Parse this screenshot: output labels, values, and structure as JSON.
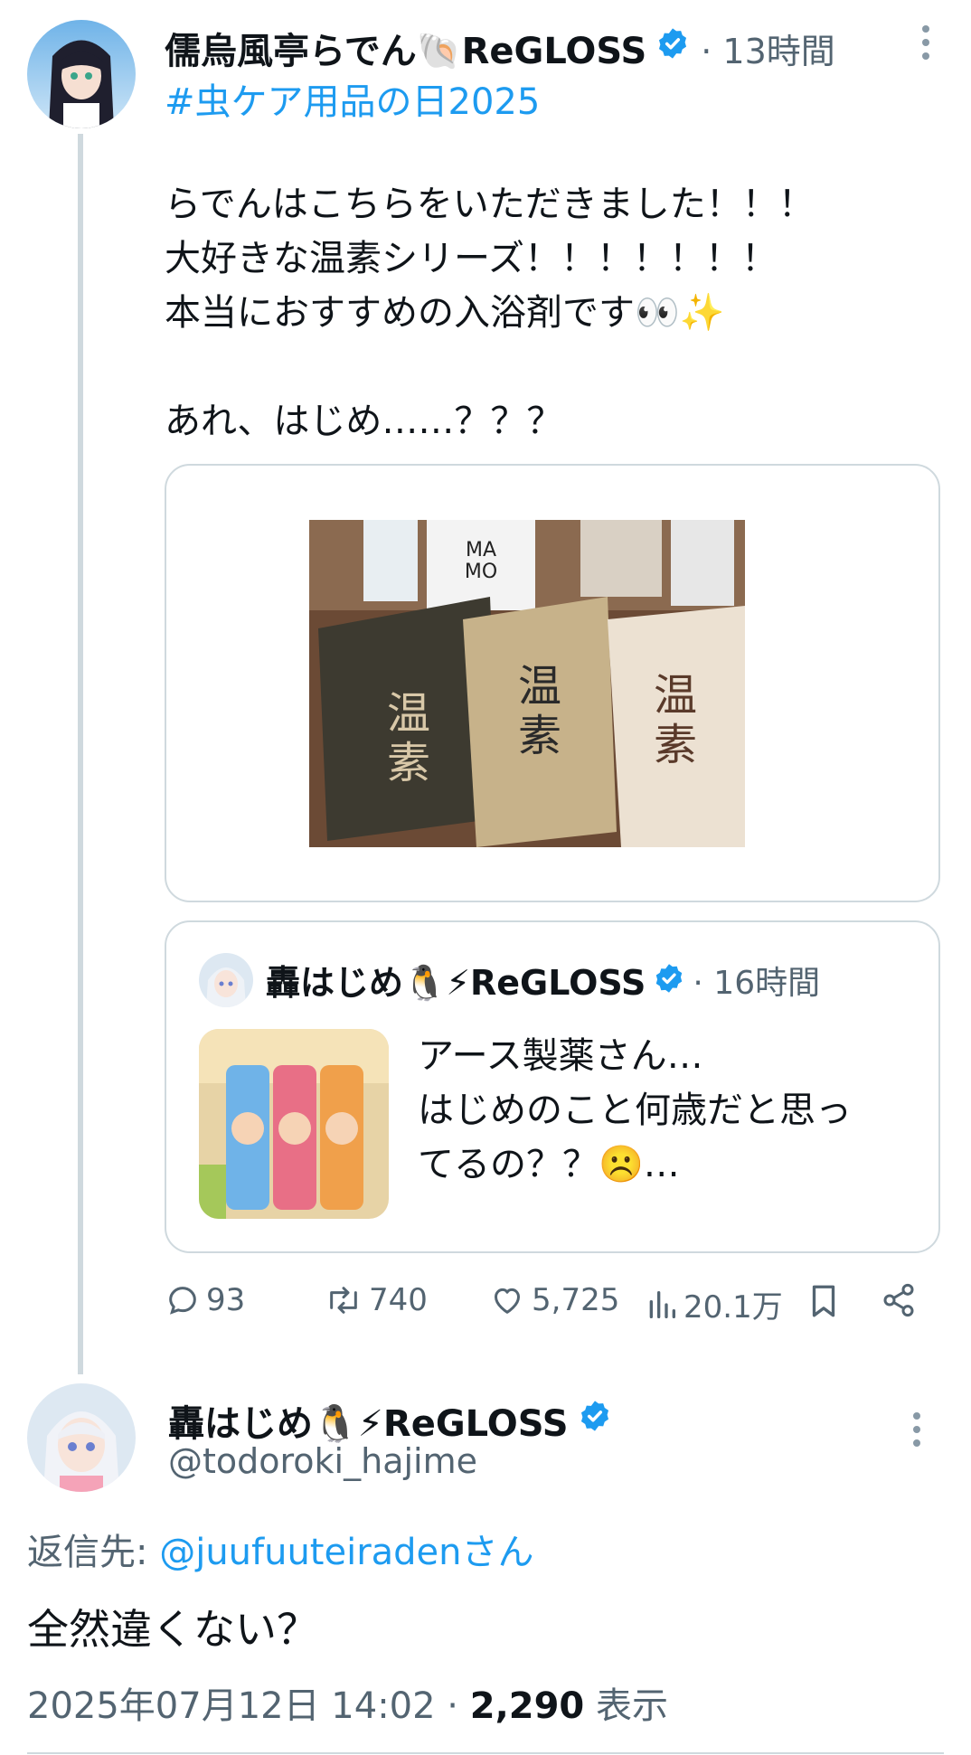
{
  "tweet": {
    "author_name": "儒烏風亭らでん🐚ReGLOSS",
    "time": "· 13時間",
    "hashtag": "#虫ケア用品の日2025",
    "lines": [
      "らでんはこちらをいただきました！！！",
      "大好きな温素シリーズ！！！！！！！",
      "本当におすすめの入浴剤です👀✨",
      "",
      "あれ、はじめ……？？？"
    ],
    "image_alt": "温素 入浴剤",
    "quote": {
      "author_name": "轟はじめ🐧⚡ReGLOSS",
      "time": "· 16時間",
      "text_lines": [
        "アース製薬さん…",
        "はじめのこと何歳だと思っ",
        "てるの？？☹️…"
      ]
    },
    "actions": {
      "replies": "93",
      "retweets": "740",
      "likes": "5,725",
      "views": "20.1万"
    }
  },
  "reply": {
    "author_name": "轟はじめ🐧⚡ReGLOSS",
    "handle": "@todoroki_hajime",
    "reply_label": "返信先: ",
    "reply_handle": "@juufuuteiradenさん",
    "text": "全然違くない？",
    "date": "2025年07月12日 14:02 · ",
    "views_count": "2,290",
    "views_label": " 表示"
  },
  "colors": {
    "accent": "#1d9bf0",
    "text": "#0f1419",
    "secondary": "#536471",
    "border": "#cfd9de"
  }
}
